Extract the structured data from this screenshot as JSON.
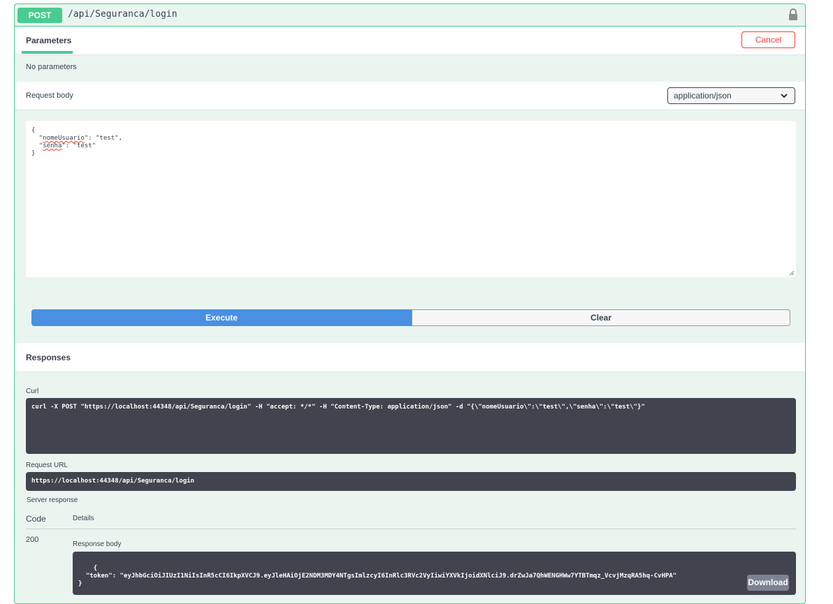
{
  "summary": {
    "method": "POST",
    "path": "/api/Seguranca/login",
    "lock_icon": "lock-icon"
  },
  "tabs": {
    "parameters_label": "Parameters",
    "cancel_label": "Cancel"
  },
  "parameters": {
    "empty_text": "No parameters"
  },
  "request_body": {
    "label": "Request body",
    "content_type": "application/json",
    "lines": [
      {
        "pre": "{",
        "key": "",
        "post": ""
      },
      {
        "pre": "  \"",
        "key": "nomeUsuario",
        "post": "\": \"test\","
      },
      {
        "pre": "  \"",
        "key": "senha",
        "post": "\": \"test\""
      },
      {
        "pre": "}",
        "key": "",
        "post": ""
      }
    ]
  },
  "actions": {
    "execute_label": "Execute",
    "clear_label": "Clear"
  },
  "responses": {
    "title": "Responses",
    "curl_label": "Curl",
    "curl_command": "curl -X POST \"https://localhost:44348/api/Seguranca/login\" -H \"accept: */*\" -H \"Content-Type: application/json\" -d \"{\\\"nomeUsuario\\\":\\\"test\\\",\\\"senha\\\":\\\"test\\\"}\"",
    "request_url_label": "Request URL",
    "request_url": "https://localhost:44348/api/Seguranca/login",
    "server_response_label": "Server response",
    "code_header": "Code",
    "details_header": "Details",
    "status_code": "200",
    "response_body_label": "Response body",
    "response_body": "{\n  \"token\": \"eyJhbGciOiJIUzI1NiIsInR5cCI6IkpXVCJ9.eyJleHAiOjE2NDM3MDY4NTgsImlzcyI6InRlc3RVc2VyIiwiYXVkIjoidXNlciJ9.drZwJa7QhWENGHWw7YTBTmqz_VcvjMzqRA5hq-CvHPA\"\n}",
    "download_label": "Download"
  },
  "colors": {
    "post": "#49cc90",
    "execute": "#4990e2",
    "cancel": "#f93e3e",
    "code_bg": "#41444e"
  }
}
